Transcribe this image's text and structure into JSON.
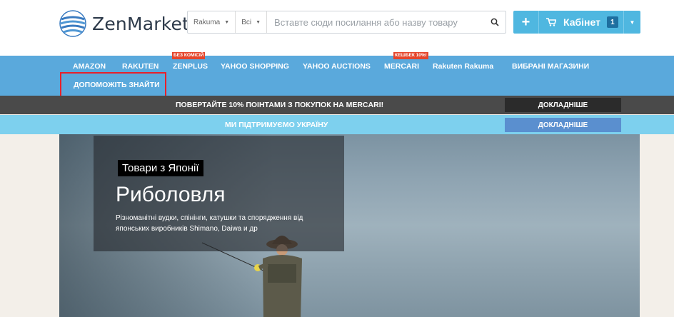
{
  "header": {
    "logo_text": "ZenMarket",
    "search": {
      "store_select": "Rakuma",
      "category_select": "Всі",
      "placeholder": "Вставте сюди посилання або назву товару"
    },
    "cabinet": {
      "label": "Кабінет",
      "count": "1"
    }
  },
  "nav": {
    "items": [
      {
        "label": "AMAZON"
      },
      {
        "label": "RAKUTEN"
      },
      {
        "label": "ZENPLUS",
        "badge": "БЕЗ КОМІСІЙ"
      },
      {
        "label": "YAHOO SHOPPING"
      },
      {
        "label": "YAHOO AUCTIONS"
      },
      {
        "label": "MERCARI",
        "badge": "КЕШБЕК 10%!"
      },
      {
        "label": "Rakuten Rakuma"
      },
      {
        "label": "ВИБРАНІ МАГАЗИНИ"
      }
    ],
    "help_label": "ДОПОМОЖІТЬ ЗНАЙТИ"
  },
  "banners": {
    "mercari": {
      "text": "ПОВЕРТАЙТЕ 10% ПОІНТАМИ З ПОКУПОК НА MERCARI!",
      "button": "ДОКЛАДНІШЕ"
    },
    "ukraine": {
      "text": "МИ ПІДТРИМУЄМО УКРАЇНУ",
      "button": "ДОКЛАДНІШЕ"
    }
  },
  "hero": {
    "tag": "Товари з Японії",
    "title": "Риболовля",
    "description": "Різноманітні вудки, спінінги, катушки та спорядження від японських виробників Shimano, Daiwa и др"
  },
  "colors": {
    "nav_bg": "#5aa9dc",
    "cabinet_bg": "#4fb7e0",
    "badge_red": "#e5452b",
    "dark_bar": "#4a4a4a",
    "light_bar": "#7dd0ee"
  }
}
